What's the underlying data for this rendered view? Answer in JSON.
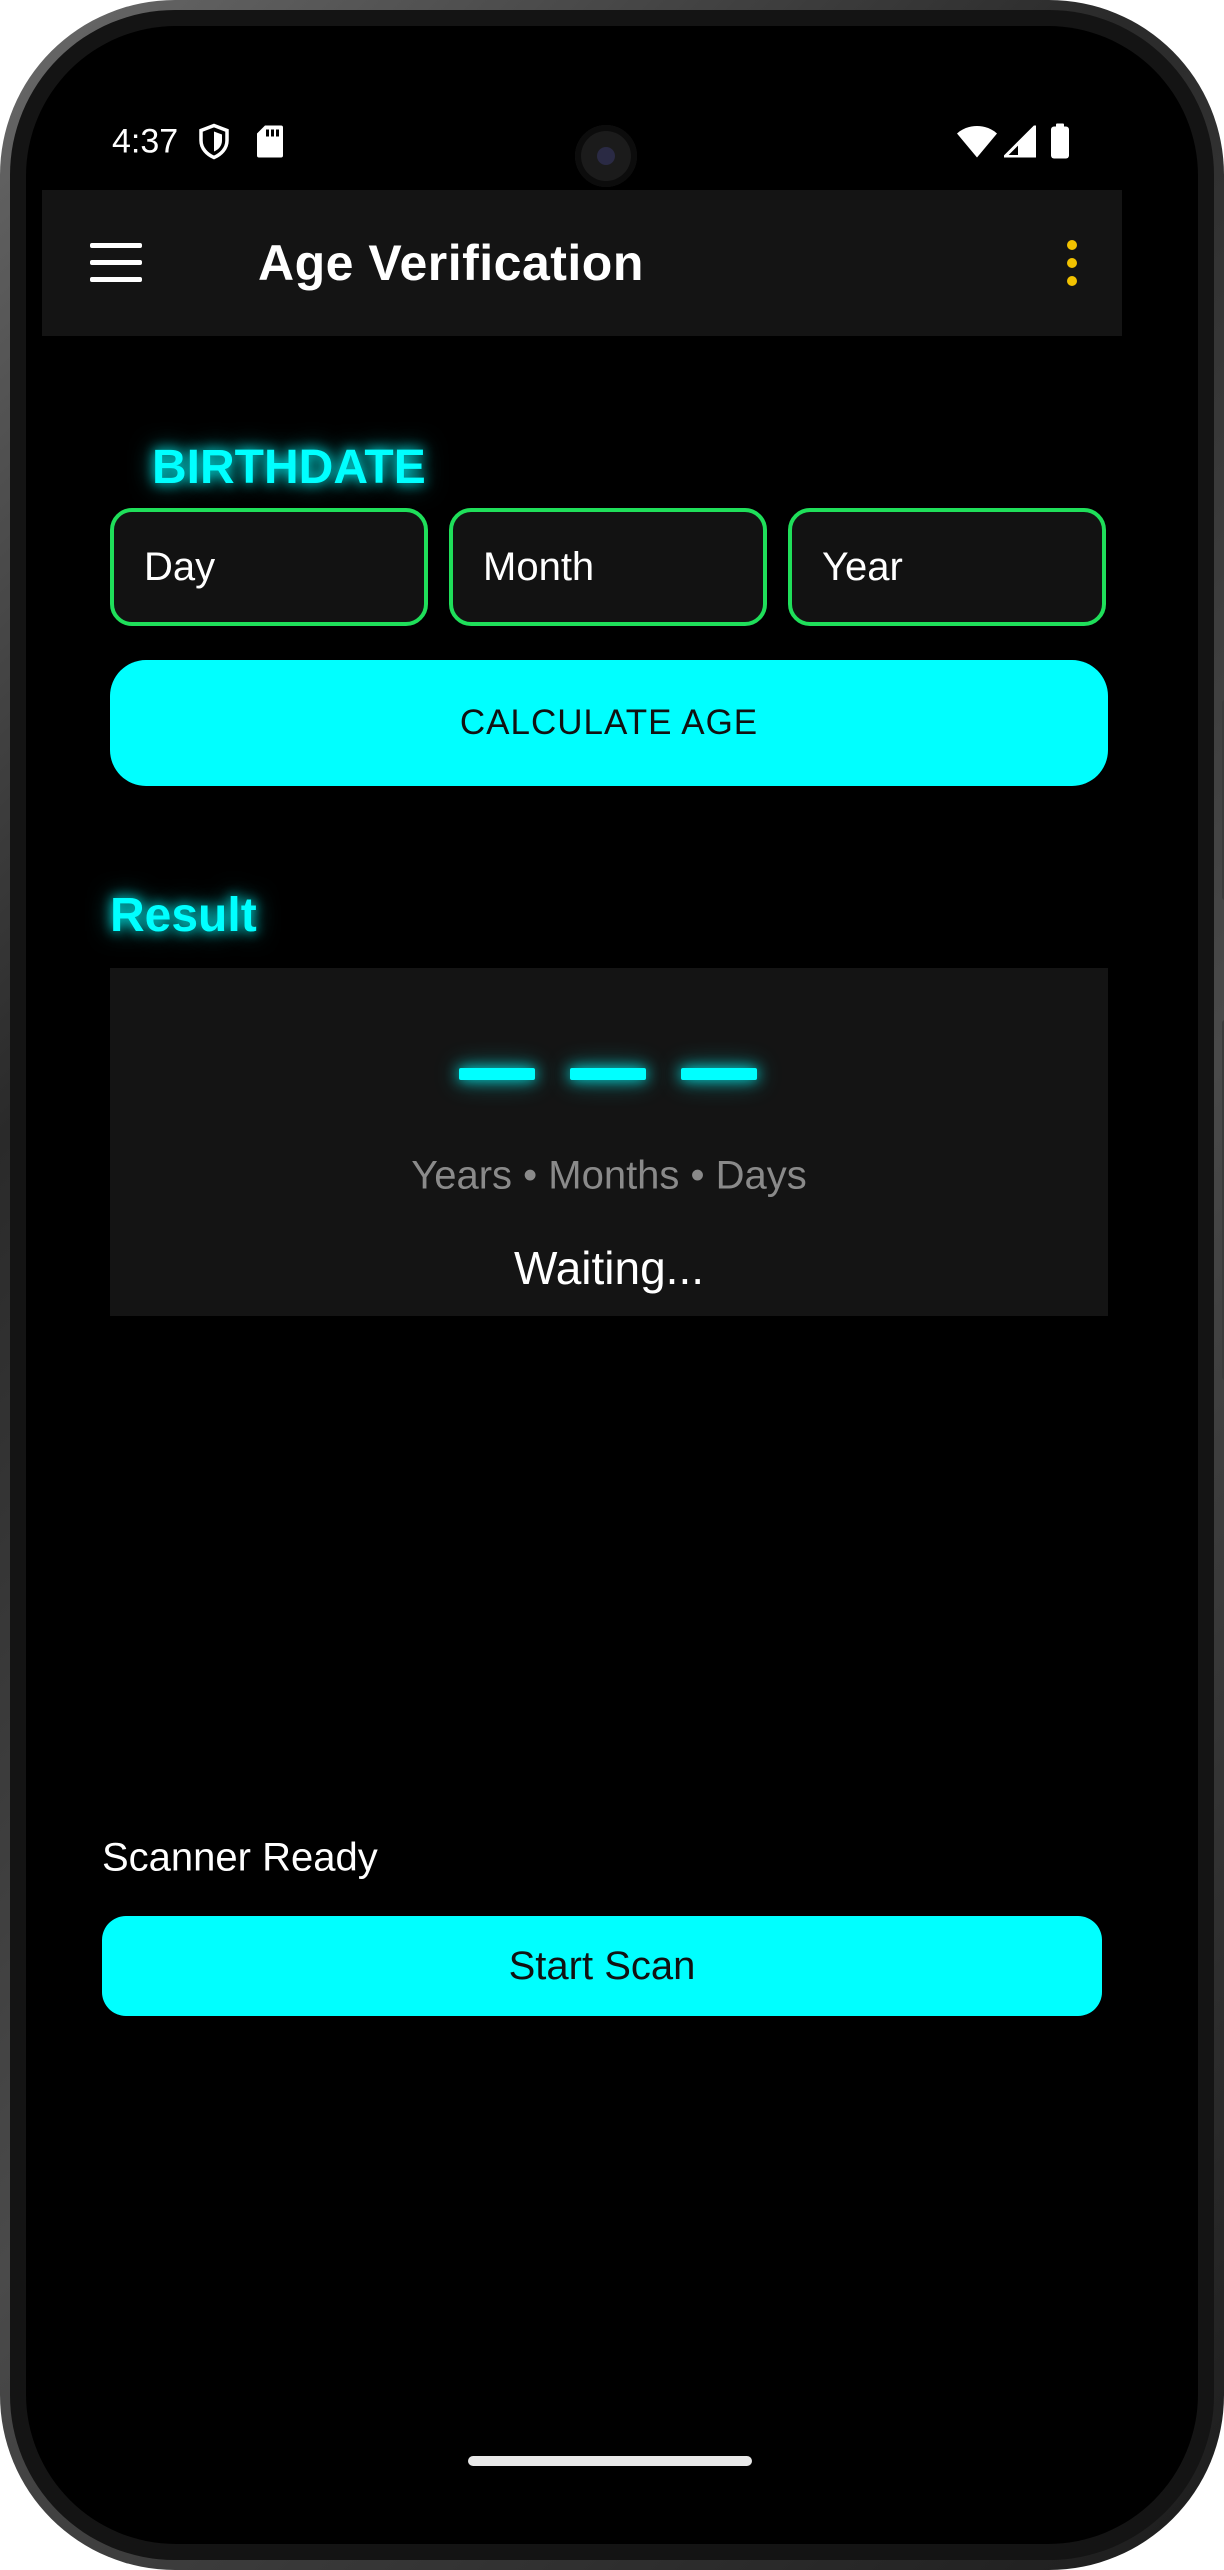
{
  "status_bar": {
    "time": "4:37",
    "icons": [
      "shield-icon",
      "sd-card-icon",
      "wifi-icon",
      "cell-signal-icon",
      "battery-icon"
    ]
  },
  "app_bar": {
    "title": "Age Verification",
    "menu_icon": "hamburger-menu-icon",
    "overflow_icon": "more-vertical-icon",
    "overflow_color": "#f2c200"
  },
  "birthdate": {
    "label": "BIRTHDATE",
    "day_placeholder": "Day",
    "month_placeholder": "Month",
    "year_placeholder": "Year",
    "calculate_label": "CALCULATE AGE"
  },
  "result": {
    "label": "Result",
    "units": "Years • Months • Days",
    "status": "Waiting..."
  },
  "scanner": {
    "status": "Scanner Ready",
    "button_label": "Start Scan"
  },
  "colors": {
    "accent": "#00ffff",
    "field_border": "#1fdf5a",
    "background": "#000000",
    "surface": "#141414"
  }
}
